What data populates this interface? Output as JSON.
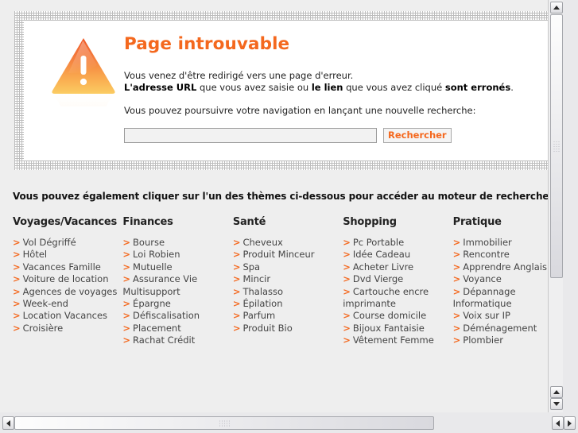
{
  "error_panel": {
    "icon": "warning-triangle-icon",
    "title": "Page introuvable",
    "line1": "Vous venez d'être redirigé vers une page d'erreur.",
    "line2_part1": "L'adresse URL",
    "line2_part2": " que vous avez saisie ou ",
    "line2_part3": "le lien",
    "line2_part4": " que vous avez cliqué ",
    "line2_part5": "sont erronés",
    "line2_part6": ".",
    "line3": "Vous pouvez poursuivre votre navigation en lançant une nouvelle recherche:",
    "search_value": "",
    "search_placeholder": "",
    "search_button": "Rechercher"
  },
  "themes": {
    "intro": "Vous pouvez également cliquer sur l'un des thèmes ci-dessous pour accéder au moteur de recherche :",
    "bullet": ">",
    "columns": [
      {
        "header": "Voyages/Vacances",
        "links": [
          "Vol Dégriffé",
          "Hôtel",
          "Vacances Famille",
          "Voiture de location",
          "Agences de voyages",
          "Week-end",
          "Location Vacances",
          "Croisière"
        ]
      },
      {
        "header": "Finances",
        "links": [
          "Bourse",
          "Loi Robien",
          "Mutuelle",
          "Assurance Vie Multisupport",
          "Épargne",
          "Défiscalisation",
          "Placement",
          "Rachat Crédit"
        ]
      },
      {
        "header": "Santé",
        "links": [
          "Cheveux",
          "Produit Minceur",
          "Spa",
          "Mincir",
          "Thalasso",
          "Épilation",
          "Parfum",
          "Produit Bio"
        ]
      },
      {
        "header": "Shopping",
        "links": [
          "Pc Portable",
          "Idée Cadeau",
          "Acheter Livre",
          "Dvd Vierge",
          "Cartouche encre imprimante",
          "Course domicile",
          "Bijoux Fantaisie",
          "Vêtement Femme"
        ]
      },
      {
        "header": "Pratique",
        "links": [
          "Immobilier",
          "Rencontre",
          "Apprendre Anglais",
          "Voyance",
          "Dépannage Informatique",
          "Voix sur IP",
          "Déménagement",
          "Plombier"
        ]
      }
    ]
  },
  "colors": {
    "accent": "#f4681e",
    "page_background": "#eeeeee",
    "panel_background": "#ffffff",
    "text": "#444444"
  },
  "scrollbars": {
    "vertical": "vertical-scrollbar",
    "horizontal": "horizontal-scrollbar",
    "up_arrow": "scroll-up-arrow",
    "down_arrow": "scroll-down-arrow",
    "left_arrow": "scroll-left-arrow",
    "right_arrow": "scroll-right-arrow"
  }
}
